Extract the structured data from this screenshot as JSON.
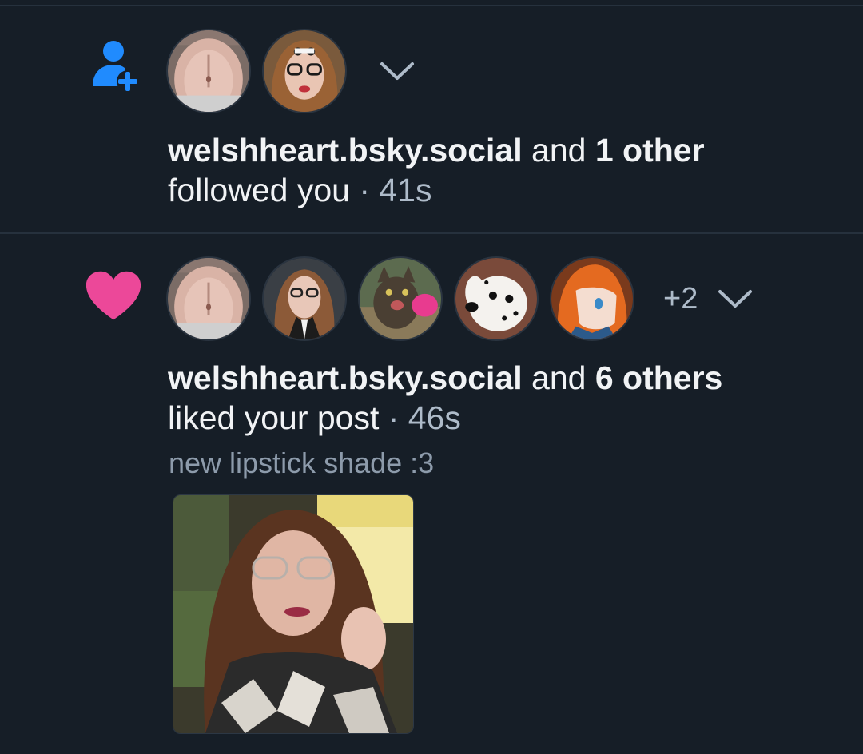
{
  "notifications": [
    {
      "type": "follow",
      "type_icon": "person-add-icon",
      "avatars": [
        "avatar-welshheart",
        "avatar-glasses-user"
      ],
      "expand_icon": "chevron-down-icon",
      "author": "welshheart.bsky.social",
      "connector": " and ",
      "others": "1 other",
      "action": "followed you",
      "separator": " · ",
      "time": "41s"
    },
    {
      "type": "like",
      "type_icon": "heart-icon",
      "avatars": [
        "avatar-welshheart",
        "avatar-redhead-glasses",
        "avatar-cat",
        "avatar-dalmatian",
        "avatar-anime-girl"
      ],
      "more_count": "+2",
      "expand_icon": "chevron-down-icon",
      "author": "welshheart.bsky.social",
      "connector": " and ",
      "others": "6 others",
      "action": "liked your post",
      "separator": " · ",
      "time": "46s",
      "post_snippet": "new lipstick shade :3",
      "post_image": "selfie-photo"
    }
  ],
  "colors": {
    "background": "#161e27",
    "follow_icon": "#208bfe",
    "like_icon": "#ec4899",
    "text_primary": "#f1f3f5",
    "text_secondary": "#aebbc9",
    "divider": "#26313d"
  }
}
